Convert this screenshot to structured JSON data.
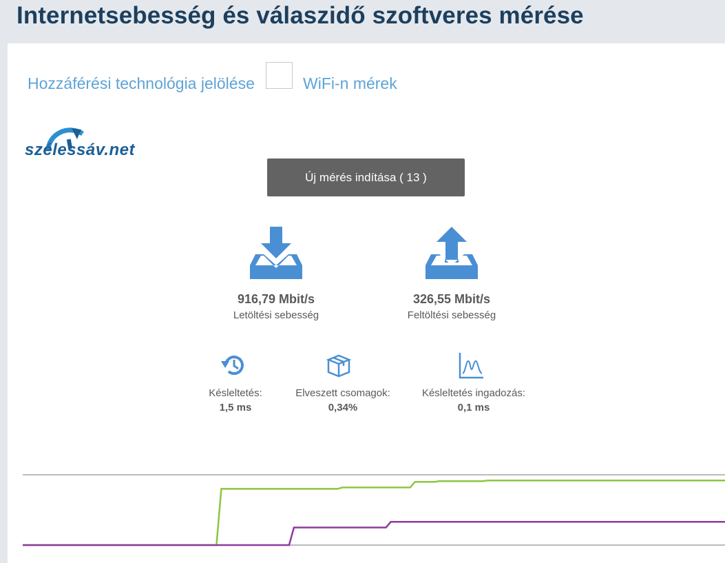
{
  "header": {
    "title": "Internetsebesség és válaszidő szoftveres mérése"
  },
  "access": {
    "label": "Hozzáférési technológia jelölése",
    "wifi_label": "WiFi-n mérek",
    "wifi_checked": false
  },
  "logo": {
    "text": "szélessáv.net"
  },
  "start_button": {
    "label": "Új mérés indítása ( 13 )"
  },
  "download": {
    "value": "916,79 Mbit/s",
    "label": "Letöltési sebesség",
    "icon": "download-icon"
  },
  "upload": {
    "value": "326,55 Mbit/s",
    "label": "Feltöltési sebesség",
    "icon": "upload-icon"
  },
  "latency": {
    "label": "Késleltetés:",
    "value": "1,5 ms",
    "icon": "latency-history-icon"
  },
  "packet_loss": {
    "label": "Elveszett csomagok:",
    "value": "0,34%",
    "icon": "package-box-icon"
  },
  "jitter": {
    "label": "Késleltetés ingadozás:",
    "value": "0,1 ms",
    "icon": "jitter-graph-icon"
  },
  "colors": {
    "accent_blue": "#4a8fd4",
    "heading": "#1d3f5e",
    "link_blue": "#5ea3d6",
    "download_line": "#8cc63f",
    "upload_line": "#8e3a9e",
    "button": "#636363"
  },
  "chart_data": {
    "type": "line",
    "series": [
      {
        "values": [
          0,
          0,
          0,
          0,
          0,
          0,
          0,
          0,
          0,
          0.8,
          0.8,
          0.8,
          0.8,
          0.8,
          0.82,
          0.82,
          0.82,
          0.9,
          0.91,
          0.91,
          0.92,
          0.92,
          0.92,
          0.92,
          0.92,
          0.92,
          0.92,
          0.92,
          0.92,
          0.92
        ]
      },
      {
        "values": [
          0,
          0,
          0,
          0,
          0,
          0,
          0,
          0,
          0,
          0,
          0,
          0,
          0.25,
          0.25,
          0.25,
          0.25,
          0.33,
          0.33,
          0.33,
          0.33,
          0.33,
          0.33,
          0.33,
          0.33,
          0.33,
          0.33,
          0.33,
          0.33,
          0.33,
          0.33
        ]
      }
    ],
    "grid": false
  }
}
